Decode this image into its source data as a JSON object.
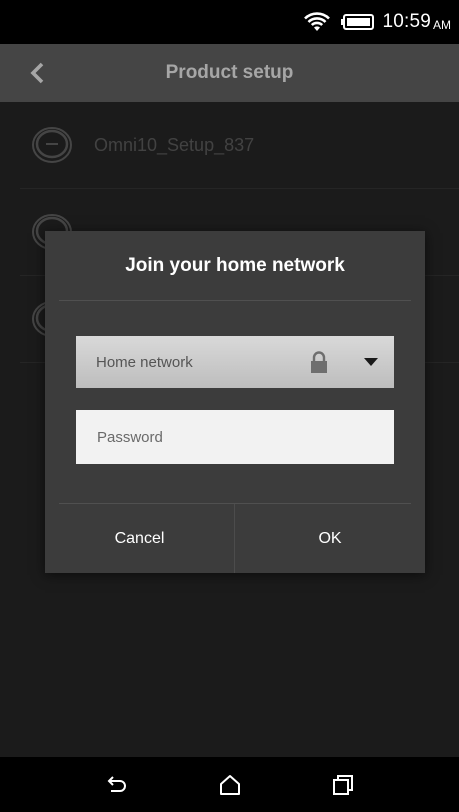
{
  "status": {
    "time": "10:59",
    "ampm": "AM",
    "icons": [
      "wifi-icon",
      "battery-icon"
    ]
  },
  "header": {
    "title": "Product setup",
    "back_icon": "chevron-left-icon"
  },
  "devices": [
    {
      "label": "Omni10_Setup_837",
      "icon": "speaker-icon"
    },
    {
      "label": "",
      "icon": "speaker-icon"
    },
    {
      "label": "",
      "icon": "speaker-icon"
    }
  ],
  "dialog": {
    "title": "Join your home network",
    "network_select": {
      "value": "Home network",
      "lock_icon": "lock-icon",
      "dropdown_icon": "caret-down-icon"
    },
    "password": {
      "placeholder": "Password",
      "value": ""
    },
    "cancel_label": "Cancel",
    "ok_label": "OK"
  },
  "nav": {
    "icons": [
      "back-nav-icon",
      "home-nav-icon",
      "recents-nav-icon"
    ]
  },
  "colors": {
    "header_bg": "#6b6b6b",
    "app_bg": "#2a2a2a",
    "dialog_bg": "#3c3c3c"
  }
}
